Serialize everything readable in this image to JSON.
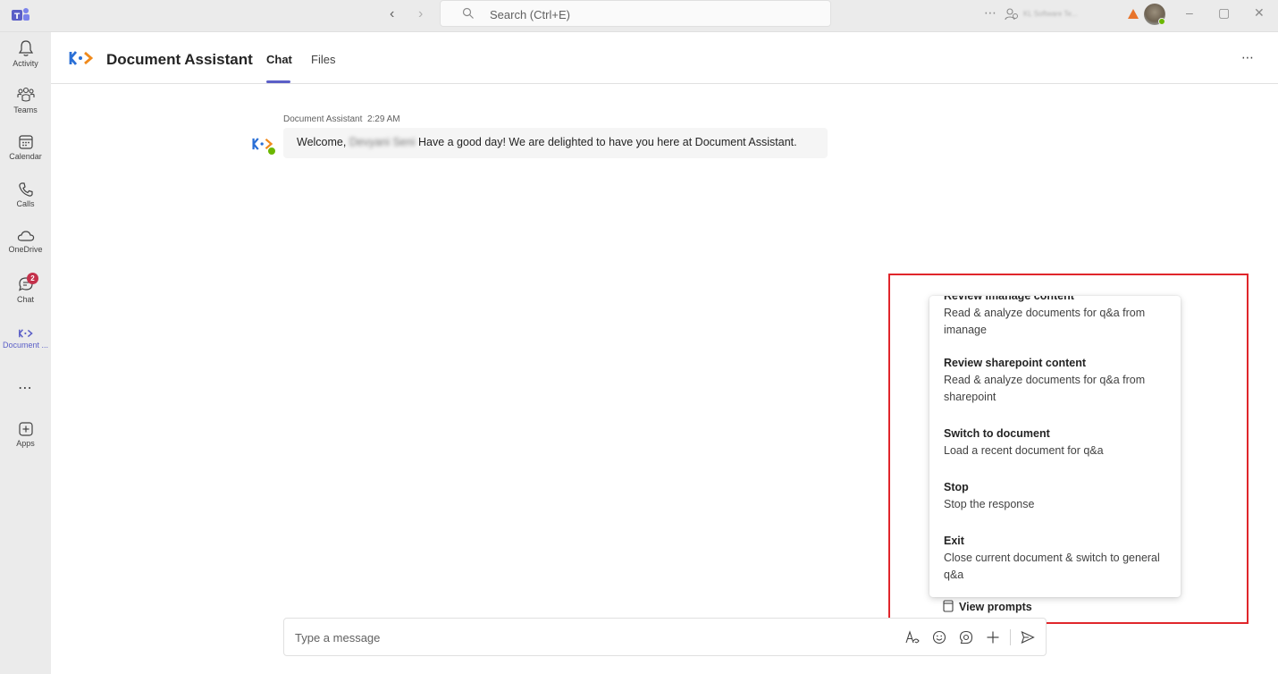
{
  "titlebar": {
    "search_placeholder": "Search (Ctrl+E)",
    "org_name": "KL Software Te..."
  },
  "rail": {
    "items": [
      {
        "label": "Activity",
        "icon": "bell-icon"
      },
      {
        "label": "Teams",
        "icon": "teams-icon"
      },
      {
        "label": "Calendar",
        "icon": "calendar-icon"
      },
      {
        "label": "Calls",
        "icon": "phone-icon"
      },
      {
        "label": "OneDrive",
        "icon": "cloud-icon"
      },
      {
        "label": "Chat",
        "icon": "chat-icon",
        "badge": "2"
      },
      {
        "label": "Document ...",
        "icon": "document-assistant-icon"
      },
      {
        "label": "",
        "icon": "more-apps-icon"
      },
      {
        "label": "Apps",
        "icon": "add-app-icon"
      }
    ]
  },
  "header": {
    "app_name": "Document Assistant",
    "tabs": [
      "Chat",
      "Files"
    ]
  },
  "message": {
    "sender": "Document Assistant",
    "time": "2:29 AM",
    "text_prefix": "Welcome,",
    "user_name": "Devyani Seni",
    "text_suffix": "Have a good day! We are delighted to have you here at Document Assistant."
  },
  "commands": {
    "partial_title": "Review imanage content",
    "items": [
      {
        "title": "",
        "desc": "Read & analyze documents for q&a from imanage"
      },
      {
        "title": "Review sharepoint content",
        "desc": "Read & analyze documents for q&a from sharepoint"
      },
      {
        "title": "Switch to document",
        "desc": "Load a recent document for q&a"
      },
      {
        "title": "Stop",
        "desc": "Stop the response"
      },
      {
        "title": "Exit",
        "desc": "Close current document & switch to general q&a"
      }
    ],
    "view_prompts_label": "View prompts"
  },
  "composer": {
    "placeholder": "Type a message"
  },
  "colors": {
    "accent": "#5b5fc7",
    "highlight_box": "#e0262b",
    "presence": "#6bb700",
    "badge": "#c4314b"
  }
}
